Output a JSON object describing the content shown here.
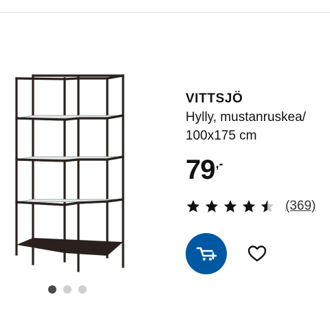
{
  "product": {
    "name": "VITTSJÖ",
    "description_line1": "Hylly, mustanruskea/",
    "description_line2": "100x175 cm",
    "price_main": "79",
    "price_suffix": ",-",
    "rating": {
      "stars": 4.5,
      "max": 5,
      "review_count": "(369)"
    }
  },
  "gallery": {
    "image_count": 3,
    "active_index": 0
  },
  "icons": {
    "cart": "add-to-cart-icon",
    "favourite": "heart-icon",
    "star": "star-icon"
  },
  "colors": {
    "accent": "#0058a3",
    "text": "#111111",
    "frame": "#2a211c",
    "inactive_dot": "#cfcfcf",
    "active_dot": "#4a4a4a"
  }
}
